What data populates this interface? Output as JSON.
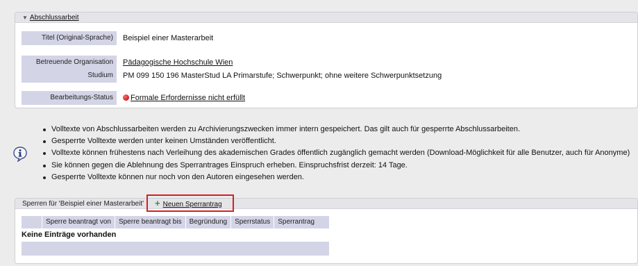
{
  "thesis": {
    "section_title": "Abschlussarbeit",
    "fields": [
      {
        "label": "Titel (Original-Sprache)",
        "value": "Beispiel einer Masterarbeit"
      },
      {
        "label": "Betreuende Organisation",
        "value": "Pädagogische Hochschule Wien"
      },
      {
        "label": "Studium",
        "value": "PM 099 150 196 MasterStud LA Primarstufe; Schwerpunkt; ohne weitere Schwerpunktsetzung"
      },
      {
        "label": "Bearbeitungs-Status",
        "value": "Formale Erfordernisse nicht erfüllt"
      }
    ],
    "status_color": "#c80000"
  },
  "info": {
    "icon": "info-icon",
    "items": [
      "Volltexte von Abschlussarbeiten werden zu Archivierungszwecken immer intern gespeichert. Das gilt auch für gesperrte Abschlussarbeiten.",
      "Gesperrte Volltexte werden unter keinen Umständen veröffentlicht.",
      "Volltexte können frühestens nach Verleihung des akademischen Grades öffentlich zugänglich gemacht werden (Download-Möglichkeit für alle Benutzer, auch für Anonyme)",
      "Sie können gegen die Ablehnung des Sperrantrages Einspruch erheben. Einspruchsfrist derzeit: 14 Tage.",
      "Gesperrte Volltexte können nur noch von den Autoren eingesehen werden."
    ]
  },
  "locks": {
    "section_title": "Sperren für 'Beispiel einer Masterarbeit'",
    "new_button_label": "Neuen Sperrantrag",
    "highlight_color": "#d42020",
    "columns": [
      "",
      "Sperre beantragt von",
      "Sperre beantragt bis",
      "Begründung",
      "Sperrstatus",
      "Sperrantrag"
    ],
    "empty_message": "Keine Einträge vorhanden"
  }
}
